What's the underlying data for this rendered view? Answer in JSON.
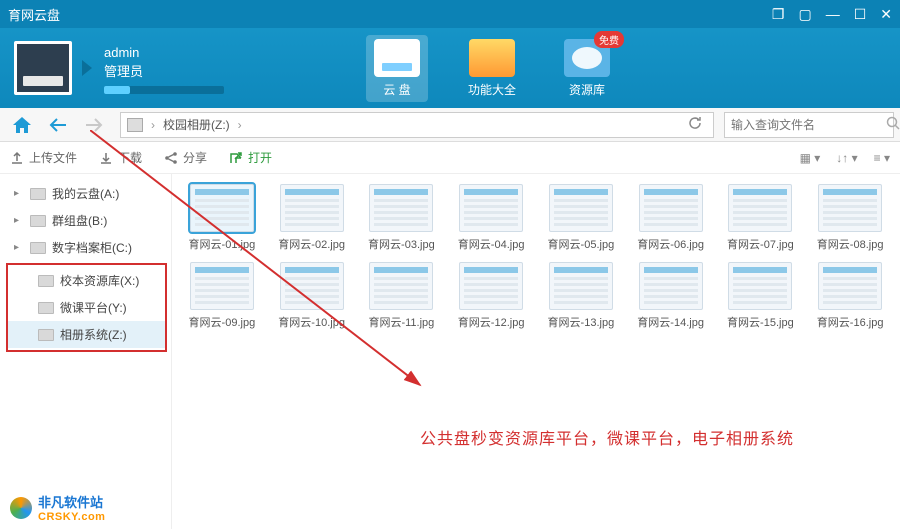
{
  "titlebar": {
    "title": "育网云盘"
  },
  "user": {
    "name": "admin",
    "role": "管理员"
  },
  "top_tabs": [
    {
      "label": "云 盘",
      "icon": "disk",
      "active": true
    },
    {
      "label": "功能大全",
      "icon": "tools",
      "active": false
    },
    {
      "label": "资源库",
      "icon": "res",
      "active": false,
      "free": "免费"
    }
  ],
  "breadcrumb": {
    "path": "校园相册(Z:)",
    "sep": "›"
  },
  "search": {
    "placeholder": "输入查询文件名"
  },
  "toolbar": {
    "upload": "上传文件",
    "download": "下载",
    "share": "分享",
    "open": "打开"
  },
  "sidebar": {
    "items": [
      {
        "label": "我的云盘(A:)",
        "expandable": true
      },
      {
        "label": "群组盘(B:)",
        "expandable": true
      },
      {
        "label": "数字档案柜(C:)",
        "expandable": true
      }
    ],
    "boxed": [
      {
        "label": "校本资源库(X:)"
      },
      {
        "label": "微课平台(Y:)"
      },
      {
        "label": "相册系统(Z:)",
        "selected": true
      }
    ]
  },
  "files": [
    {
      "name": "育网云-01.jpg",
      "selected": true
    },
    {
      "name": "育网云-02.jpg"
    },
    {
      "name": "育网云-03.jpg"
    },
    {
      "name": "育网云-04.jpg"
    },
    {
      "name": "育网云-05.jpg"
    },
    {
      "name": "育网云-06.jpg"
    },
    {
      "name": "育网云-07.jpg"
    },
    {
      "name": "育网云-08.jpg"
    },
    {
      "name": "育网云-09.jpg"
    },
    {
      "name": "育网云-10.jpg"
    },
    {
      "name": "育网云-11.jpg"
    },
    {
      "name": "育网云-12.jpg"
    },
    {
      "name": "育网云-13.jpg"
    },
    {
      "name": "育网云-14.jpg"
    },
    {
      "name": "育网云-15.jpg"
    },
    {
      "name": "育网云-16.jpg"
    }
  ],
  "annotation": {
    "text": "公共盘秒变资源库平台，微课平台，电子相册系统"
  },
  "watermark": {
    "cn": "非凡软件站",
    "en": "CRSKY.com"
  }
}
